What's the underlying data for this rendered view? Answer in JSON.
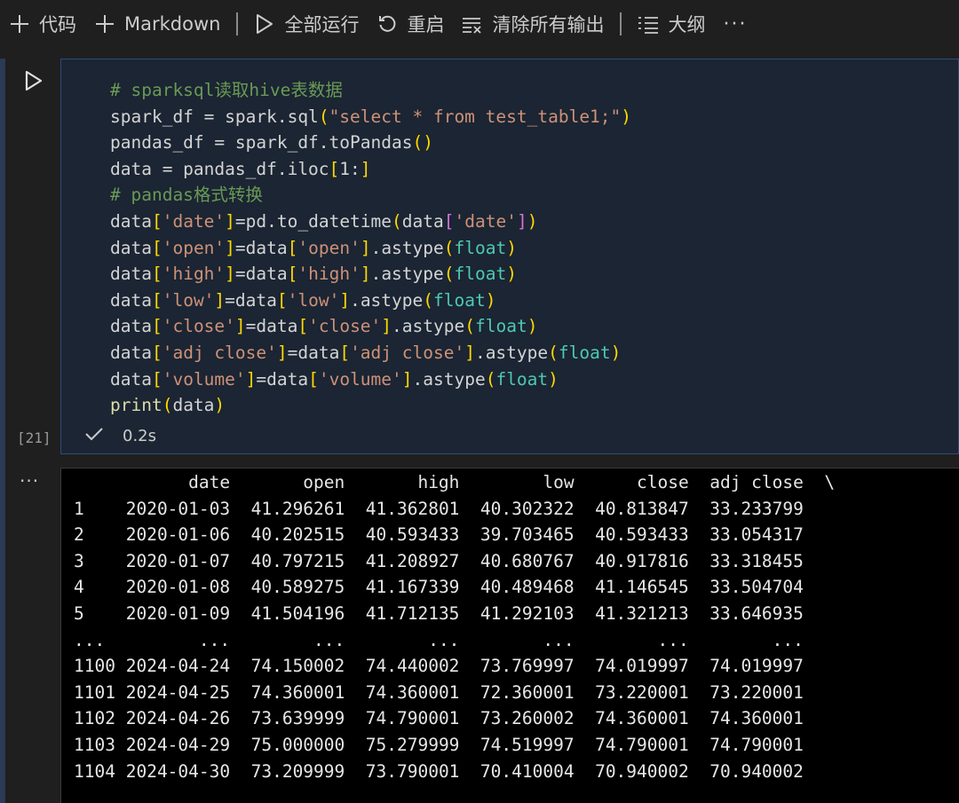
{
  "toolbar": {
    "code_label": "代码",
    "markdown_label": "Markdown",
    "run_all_label": "全部运行",
    "restart_label": "重启",
    "clear_outputs_label": "清除所有输出",
    "outline_label": "大纲",
    "more_label": "···"
  },
  "cell": {
    "execution_count": "[21]",
    "status_icon": "check-icon",
    "duration": "0.2s",
    "code_lines": [
      [
        {
          "t": "# sparksql读取hive表数据",
          "c": "comment"
        }
      ],
      [
        {
          "t": "spark_df = spark.sql",
          "c": "var"
        },
        {
          "t": "(",
          "c": "b1"
        },
        {
          "t": "\"select * from test_table1;\"",
          "c": "str"
        },
        {
          "t": ")",
          "c": "b1"
        }
      ],
      [
        {
          "t": "pandas_df = spark_df.toPandas",
          "c": "var"
        },
        {
          "t": "()",
          "c": "b1"
        }
      ],
      [
        {
          "t": "data = pandas_df.iloc",
          "c": "var"
        },
        {
          "t": "[",
          "c": "b1"
        },
        {
          "t": "1:",
          "c": "var"
        },
        {
          "t": "]",
          "c": "b1"
        }
      ],
      [
        {
          "t": "# pandas格式转换",
          "c": "comment"
        }
      ],
      [
        {
          "t": "data",
          "c": "var"
        },
        {
          "t": "[",
          "c": "b1"
        },
        {
          "t": "'date'",
          "c": "str"
        },
        {
          "t": "]",
          "c": "b1"
        },
        {
          "t": "=pd.to_datetime",
          "c": "var"
        },
        {
          "t": "(",
          "c": "b1"
        },
        {
          "t": "data",
          "c": "var"
        },
        {
          "t": "[",
          "c": "b2"
        },
        {
          "t": "'date'",
          "c": "str"
        },
        {
          "t": "]",
          "c": "b2"
        },
        {
          "t": ")",
          "c": "b1"
        }
      ],
      [
        {
          "t": "data",
          "c": "var"
        },
        {
          "t": "[",
          "c": "b1"
        },
        {
          "t": "'open'",
          "c": "str"
        },
        {
          "t": "]",
          "c": "b1"
        },
        {
          "t": "=data",
          "c": "var"
        },
        {
          "t": "[",
          "c": "b1"
        },
        {
          "t": "'open'",
          "c": "str"
        },
        {
          "t": "]",
          "c": "b1"
        },
        {
          "t": ".astype",
          "c": "var"
        },
        {
          "t": "(",
          "c": "b1"
        },
        {
          "t": "float",
          "c": "type"
        },
        {
          "t": ")",
          "c": "b1"
        }
      ],
      [
        {
          "t": "data",
          "c": "var"
        },
        {
          "t": "[",
          "c": "b1"
        },
        {
          "t": "'high'",
          "c": "str"
        },
        {
          "t": "]",
          "c": "b1"
        },
        {
          "t": "=data",
          "c": "var"
        },
        {
          "t": "[",
          "c": "b1"
        },
        {
          "t": "'high'",
          "c": "str"
        },
        {
          "t": "]",
          "c": "b1"
        },
        {
          "t": ".astype",
          "c": "var"
        },
        {
          "t": "(",
          "c": "b1"
        },
        {
          "t": "float",
          "c": "type"
        },
        {
          "t": ")",
          "c": "b1"
        }
      ],
      [
        {
          "t": "data",
          "c": "var"
        },
        {
          "t": "[",
          "c": "b1"
        },
        {
          "t": "'low'",
          "c": "str"
        },
        {
          "t": "]",
          "c": "b1"
        },
        {
          "t": "=data",
          "c": "var"
        },
        {
          "t": "[",
          "c": "b1"
        },
        {
          "t": "'low'",
          "c": "str"
        },
        {
          "t": "]",
          "c": "b1"
        },
        {
          "t": ".astype",
          "c": "var"
        },
        {
          "t": "(",
          "c": "b1"
        },
        {
          "t": "float",
          "c": "type"
        },
        {
          "t": ")",
          "c": "b1"
        }
      ],
      [
        {
          "t": "data",
          "c": "var"
        },
        {
          "t": "[",
          "c": "b1"
        },
        {
          "t": "'close'",
          "c": "str"
        },
        {
          "t": "]",
          "c": "b1"
        },
        {
          "t": "=data",
          "c": "var"
        },
        {
          "t": "[",
          "c": "b1"
        },
        {
          "t": "'close'",
          "c": "str"
        },
        {
          "t": "]",
          "c": "b1"
        },
        {
          "t": ".astype",
          "c": "var"
        },
        {
          "t": "(",
          "c": "b1"
        },
        {
          "t": "float",
          "c": "type"
        },
        {
          "t": ")",
          "c": "b1"
        }
      ],
      [
        {
          "t": "data",
          "c": "var"
        },
        {
          "t": "[",
          "c": "b1"
        },
        {
          "t": "'adj close'",
          "c": "str"
        },
        {
          "t": "]",
          "c": "b1"
        },
        {
          "t": "=data",
          "c": "var"
        },
        {
          "t": "[",
          "c": "b1"
        },
        {
          "t": "'adj close'",
          "c": "str"
        },
        {
          "t": "]",
          "c": "b1"
        },
        {
          "t": ".astype",
          "c": "var"
        },
        {
          "t": "(",
          "c": "b1"
        },
        {
          "t": "float",
          "c": "type"
        },
        {
          "t": ")",
          "c": "b1"
        }
      ],
      [
        {
          "t": "data",
          "c": "var"
        },
        {
          "t": "[",
          "c": "b1"
        },
        {
          "t": "'volume'",
          "c": "str"
        },
        {
          "t": "]",
          "c": "b1"
        },
        {
          "t": "=data",
          "c": "var"
        },
        {
          "t": "[",
          "c": "b1"
        },
        {
          "t": "'volume'",
          "c": "str"
        },
        {
          "t": "]",
          "c": "b1"
        },
        {
          "t": ".astype",
          "c": "var"
        },
        {
          "t": "(",
          "c": "b1"
        },
        {
          "t": "float",
          "c": "type"
        },
        {
          "t": ")",
          "c": "b1"
        }
      ],
      [
        {
          "t": "print",
          "c": "fn"
        },
        {
          "t": "(",
          "c": "b1"
        },
        {
          "t": "data",
          "c": "var"
        },
        {
          "t": ")",
          "c": "b1"
        }
      ]
    ],
    "colors": {
      "comment": "#6a9955",
      "string": "#ce9178",
      "bracket_outer": "#ffd700",
      "bracket_inner": "#da70d6",
      "type": "#4ec9b0",
      "function": "#dcdcaa",
      "editor_background": "#1b2533",
      "output_background": "#000000"
    }
  },
  "output": {
    "menu_label": "···",
    "columns": [
      "date",
      "open",
      "high",
      "low",
      "close",
      "adj close"
    ],
    "trailing_marker": "\\",
    "rows": [
      [
        "1",
        "2020-01-03",
        "41.296261",
        "41.362801",
        "40.302322",
        "40.813847",
        "33.233799"
      ],
      [
        "2",
        "2020-01-06",
        "40.202515",
        "40.593433",
        "39.703465",
        "40.593433",
        "33.054317"
      ],
      [
        "3",
        "2020-01-07",
        "40.797215",
        "41.208927",
        "40.680767",
        "40.917816",
        "33.318455"
      ],
      [
        "4",
        "2020-01-08",
        "40.589275",
        "41.167339",
        "40.489468",
        "41.146545",
        "33.504704"
      ],
      [
        "5",
        "2020-01-09",
        "41.504196",
        "41.712135",
        "41.292103",
        "41.321213",
        "33.646935"
      ],
      [
        "...",
        "...",
        "...",
        "...",
        "...",
        "...",
        "..."
      ],
      [
        "1100",
        "2024-04-24",
        "74.150002",
        "74.440002",
        "73.769997",
        "74.019997",
        "74.019997"
      ],
      [
        "1101",
        "2024-04-25",
        "74.360001",
        "74.360001",
        "72.360001",
        "73.220001",
        "73.220001"
      ],
      [
        "1102",
        "2024-04-26",
        "73.639999",
        "74.790001",
        "73.260002",
        "74.360001",
        "74.360001"
      ],
      [
        "1103",
        "2024-04-29",
        "75.000000",
        "75.279999",
        "74.519997",
        "74.790001",
        "74.790001"
      ],
      [
        "1104",
        "2024-04-30",
        "73.209999",
        "73.790001",
        "70.410004",
        "70.940002",
        "70.940002"
      ]
    ]
  }
}
